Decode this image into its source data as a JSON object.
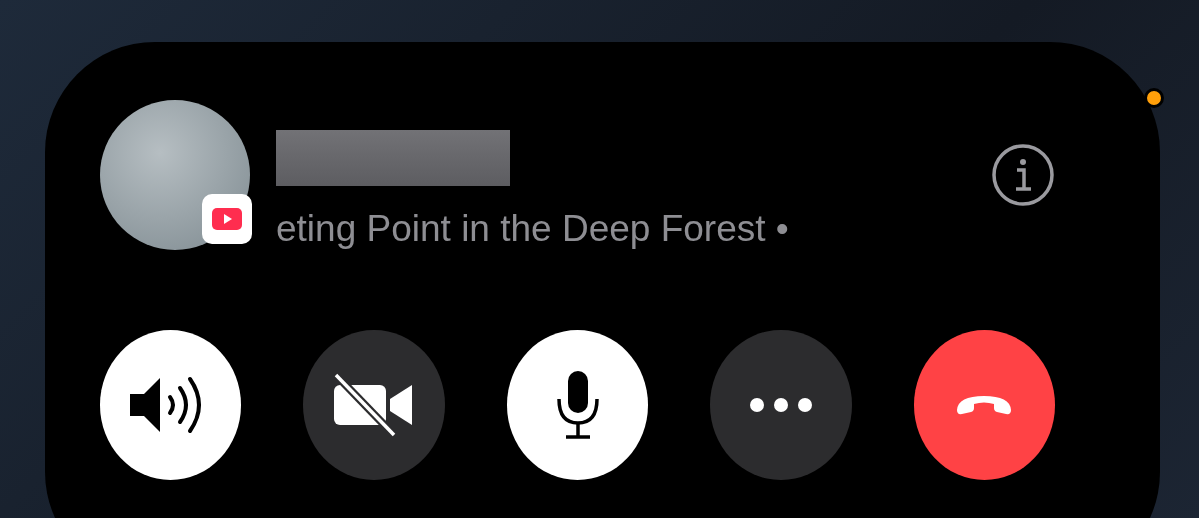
{
  "call": {
    "subtitle": "eting Point in the Deep Forest •"
  },
  "buttons": [
    {
      "kind": "speaker",
      "selected": true
    },
    {
      "kind": "camera",
      "selected": false
    },
    {
      "kind": "mic",
      "selected": true
    },
    {
      "kind": "more",
      "selected": false
    },
    {
      "kind": "end"
    }
  ]
}
